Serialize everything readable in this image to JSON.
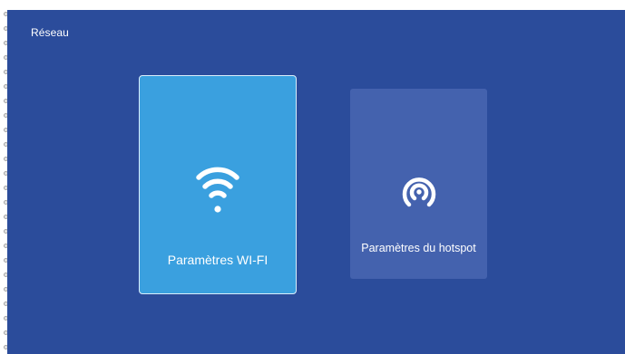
{
  "page": {
    "title": "Réseau"
  },
  "cards": [
    {
      "label": "Paramètres WI-FI",
      "icon": "wifi-icon",
      "state": "focused",
      "color": "#3aa0df"
    },
    {
      "label": "Paramètres du hotspot",
      "icon": "hotspot-icon",
      "state": "normal",
      "color": "#4462ae"
    }
  ],
  "colors": {
    "background": "#2b4c9b",
    "text": "#ffffff"
  }
}
